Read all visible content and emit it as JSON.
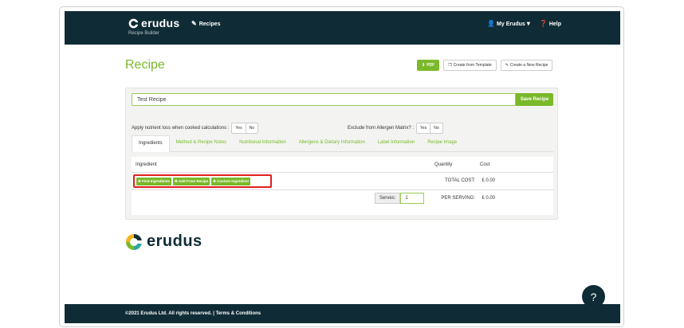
{
  "header": {
    "brand": "erudus",
    "subtitle": "Recipe Builder",
    "nav_recipes": "Recipes",
    "my_account": "My Erudus",
    "help": "Help"
  },
  "page": {
    "title": "Recipe",
    "pdf_label": "PDF",
    "create_from_template": "Create from Template",
    "create_new": "Create a New Recipe"
  },
  "form": {
    "recipe_name": "Test Recipe",
    "save_label": "Save Recipe",
    "nutrient_option_label": "Apply nutrient loss when cooked calculations :",
    "allergen_option_label": "Exclude from Allergen Matrix? :",
    "yes": "Yes",
    "no": "No"
  },
  "tabs": [
    {
      "label": "Ingredients",
      "active": true
    },
    {
      "label": "Method & Recipe Notes",
      "active": false
    },
    {
      "label": "Nutritional Information",
      "active": false
    },
    {
      "label": "Allergens & Dietary Information",
      "active": false
    },
    {
      "label": "Label Information",
      "active": false
    },
    {
      "label": "Recipe Image",
      "active": false
    }
  ],
  "table": {
    "col_ingredient": "Ingredient",
    "col_quantity": "Quantity",
    "col_cost": "Cost",
    "find_ingredients": "Find Ingredients",
    "add_from_recipe": "Add From Recipe",
    "custom_ingredient": "Custom Ingredient",
    "total_cost_label": "TOTAL COST:",
    "total_cost_value": "£ 0.00",
    "serves_label": "Serves:",
    "serves_value": "1",
    "per_serving_label": "PER SERVING:",
    "per_serving_value": "£ 0.00"
  },
  "footer": {
    "brand": "erudus",
    "copyright": "©2021 Erudus Ltd. All rights reserved. | Terms & Conditions",
    "help_fab": "?"
  },
  "colors": {
    "brand_dark": "#0f2c36",
    "accent_green": "#7ab929",
    "highlight_red": "#e0201b"
  }
}
